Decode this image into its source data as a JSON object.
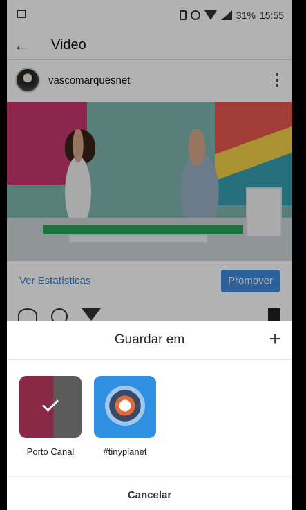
{
  "status_bar": {
    "battery": "31%",
    "time": "15:55",
    "icons": [
      "app-icon",
      "phone-icon",
      "alarm-icon",
      "wifi-icon",
      "signal-icon"
    ]
  },
  "toolbar": {
    "back_icon": "arrow-left-icon",
    "title": "Video"
  },
  "post": {
    "username": "vascomarquesnet"
  },
  "actions": {
    "stats_label": "Ver Estatísticas",
    "promote_label": "Promover"
  },
  "sheet": {
    "title": "Guardar em",
    "add_icon": "plus-icon",
    "collections": [
      {
        "name": "Porto Canal",
        "selected": true
      },
      {
        "name": "#tinyplanet",
        "selected": false
      }
    ],
    "cancel_label": "Cancelar"
  },
  "colors": {
    "accent_blue": "#3f8bdc",
    "link_blue": "#3f7ec7"
  }
}
